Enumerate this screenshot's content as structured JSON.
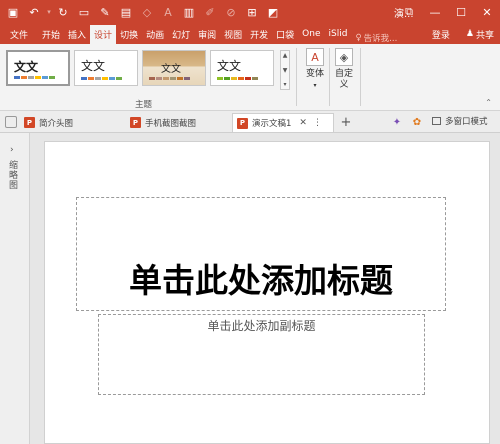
{
  "window": {
    "title": "演...",
    "controls": [
      "restore-icon",
      "minimize-icon",
      "maximize-icon",
      "close-icon"
    ]
  },
  "quick_access": [
    "save-icon",
    "undo-icon",
    "redo-icon",
    "new-file-icon",
    "pen-icon",
    "format-painter-icon",
    "shape-icon",
    "text-icon",
    "paste-icon",
    "eraser-icon",
    "clear-icon",
    "grid-icon",
    "color-icon",
    "more-icon"
  ],
  "tabs": [
    {
      "label": "文件",
      "active": false
    },
    {
      "label": "开始",
      "active": false
    },
    {
      "label": "插入",
      "active": false
    },
    {
      "label": "设计",
      "active": true
    },
    {
      "label": "切换",
      "active": false
    },
    {
      "label": "动画",
      "active": false
    },
    {
      "label": "幻灯",
      "active": false
    },
    {
      "label": "审阅",
      "active": false
    },
    {
      "label": "视图",
      "active": false
    },
    {
      "label": "开发",
      "active": false
    },
    {
      "label": "口袋",
      "active": false
    },
    {
      "label": "One",
      "active": false
    },
    {
      "label": "iSlid",
      "active": false
    }
  ],
  "tell_me": "告诉我...",
  "account": {
    "login": "登录",
    "share": "共享"
  },
  "ribbon": {
    "themes": [
      {
        "label": "文文",
        "style": "office"
      },
      {
        "label": "文文",
        "style": "plain"
      },
      {
        "label": "文文",
        "style": "wood"
      },
      {
        "label": "文文",
        "style": "facet"
      }
    ],
    "group_label": "主题",
    "variants_label": "变体",
    "customize_label": "自定义"
  },
  "doc_tabs": [
    {
      "label": "简介头图",
      "active": false
    },
    {
      "label": "手机截图截图",
      "active": false
    },
    {
      "label": "演示文稿1",
      "active": true
    }
  ],
  "multi_window": "多窗口模式",
  "thumb_pane": {
    "label": "缩略图"
  },
  "slide": {
    "title_placeholder": "单击此处添加标题",
    "subtitle_placeholder": "单击此处添加副标题"
  },
  "colors": {
    "accent": "#c9442f",
    "ribbon_bg": "#f3f3f3",
    "workspace_bg": "#e6e6e6"
  }
}
